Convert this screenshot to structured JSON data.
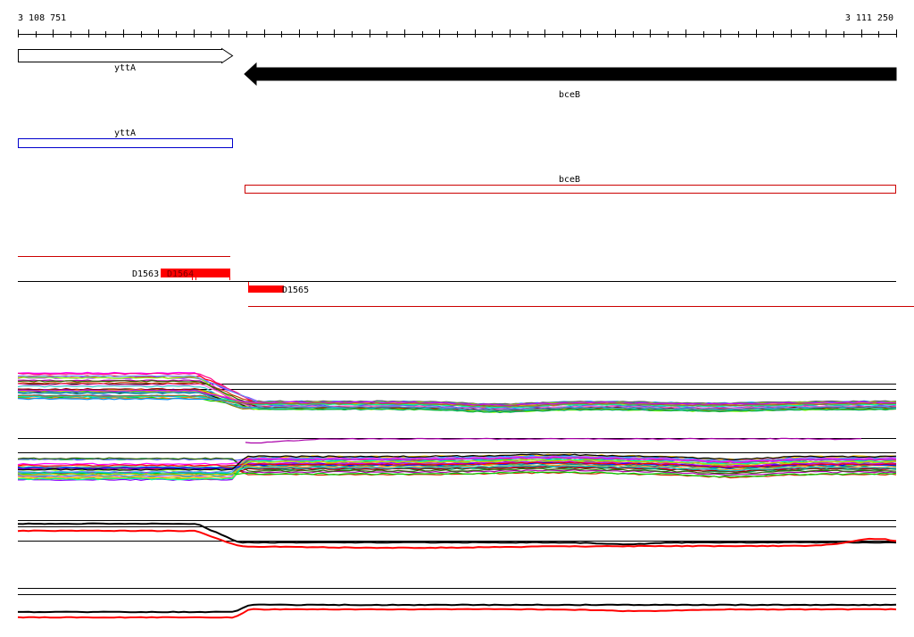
{
  "ruler": {
    "start_label": "3 108 751",
    "end_label": "3 111 250"
  },
  "genes": [
    {
      "name": "yttA",
      "strand": "+",
      "style": "outline"
    },
    {
      "name": "bceB",
      "strand": "-",
      "style": "filled"
    }
  ],
  "cds_boxes": [
    {
      "name": "yttA",
      "color": "#0000cc"
    },
    {
      "name": "bceB",
      "color": "#cc0000"
    }
  ],
  "segments": [
    {
      "label": "D1563"
    },
    {
      "label": "D1564"
    },
    {
      "label": "D1565"
    }
  ],
  "expression_panels": [
    {
      "name": "multi-sample-forward",
      "series_count": 30
    },
    {
      "name": "multi-sample-reverse",
      "series_count": 30
    },
    {
      "name": "summary-forward",
      "series": [
        "black",
        "red"
      ]
    },
    {
      "name": "summary-reverse",
      "series": [
        "black",
        "red"
      ]
    }
  ],
  "colors": {
    "highlight": "#ff0000",
    "feature_line": "#cc0000",
    "forward_box": "#0000cc",
    "reverse_box": "#cc0000"
  }
}
